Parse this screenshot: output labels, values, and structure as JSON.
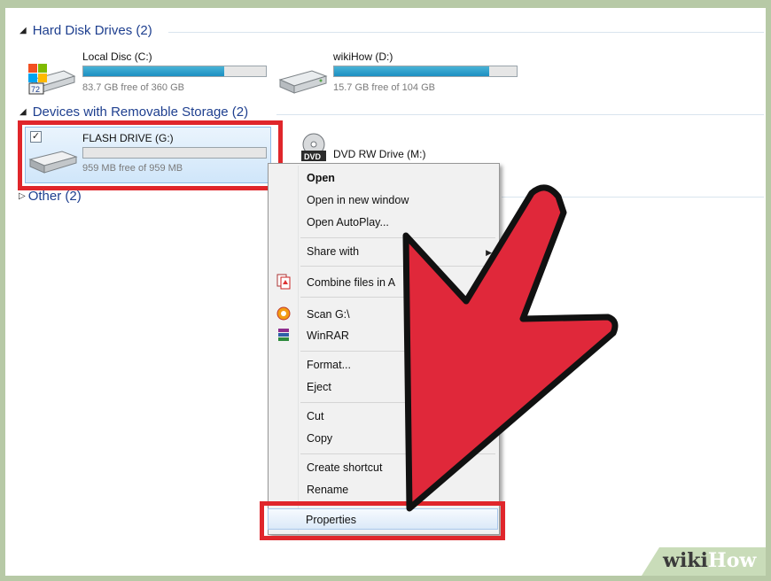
{
  "groups": {
    "hard_disk": "Hard Disk Drives (2)",
    "removable": "Devices with Removable Storage (2)",
    "other": "Other (2)"
  },
  "drives": {
    "local_c": {
      "name": "Local Disc (C:)",
      "free": "83.7 GB free of 360 GB",
      "used_fraction": 0.77
    },
    "wikihow_d": {
      "name": "wikiHow (D:)",
      "free": "15.7 GB free of 104 GB",
      "used_fraction": 0.85
    },
    "flash_g": {
      "name": "FLASH DRIVE (G:)",
      "free": "959 MB free of 959 MB",
      "used_fraction": 0.0,
      "checkbox": "✓"
    },
    "dvd_m": {
      "name": "DVD RW Drive (M:)",
      "icon_label": "DVD"
    }
  },
  "context_menu": {
    "open": "Open",
    "open_new_window": "Open in new window",
    "open_autoplay": "Open AutoPlay...",
    "share_with": "Share with",
    "combine_files": "Combine files in A",
    "scan": "Scan G:\\",
    "winrar": "WinRAR",
    "format": "Format...",
    "eject": "Eject",
    "cut": "Cut",
    "copy": "Copy",
    "create_shortcut": "Create shortcut",
    "rename": "Rename",
    "properties": "Properties",
    "submenu_arrow": "▶"
  },
  "watermark": {
    "wiki": "wiki",
    "how": "How"
  },
  "colors": {
    "highlight_box": "#e0262b",
    "arrow_fill": "#e0283a",
    "group_header": "#1e3f8f",
    "bar_fill": "#1c8fc2"
  },
  "icons": {
    "collapse_triangle": "▲",
    "expand_triangle": "▷"
  }
}
